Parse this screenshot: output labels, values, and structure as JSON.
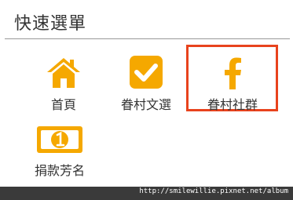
{
  "header": {
    "title": "快速選單"
  },
  "menu": {
    "items": [
      {
        "label": "首頁",
        "icon": "home-icon"
      },
      {
        "label": "眷村文選",
        "icon": "checkbox-icon"
      },
      {
        "label": "眷村社群",
        "icon": "facebook-icon"
      },
      {
        "label": "捐款芳名",
        "icon": "money-icon"
      }
    ],
    "selected_index": 2
  },
  "footer": {
    "url": "http://smilewillie.pixnet.net/album"
  },
  "colors": {
    "icon": "#f5a800",
    "highlight": "#e8431d",
    "footer_bg": "#3a3a3a"
  }
}
